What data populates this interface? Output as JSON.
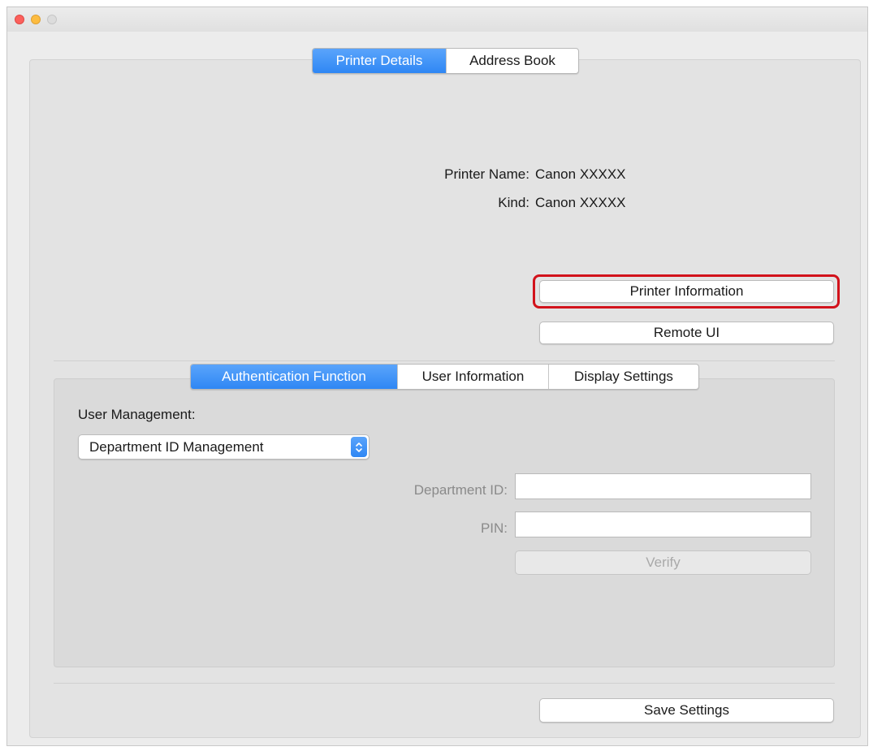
{
  "window": {
    "traffic_lights": [
      "close",
      "minimize",
      "zoom"
    ]
  },
  "top_tabs": [
    {
      "label": "Printer Details",
      "active": true
    },
    {
      "label": "Address Book",
      "active": false
    }
  ],
  "printer": {
    "name_label": "Printer Name:",
    "name_value": "Canon XXXXX",
    "kind_label": "Kind:",
    "kind_value": "Canon XXXXX"
  },
  "buttons": {
    "printer_information": "Printer Information",
    "remote_ui": "Remote UI",
    "save_settings": "Save Settings",
    "verify": "Verify"
  },
  "sub_tabs": [
    {
      "label": "Authentication Function",
      "active": true
    },
    {
      "label": "User Information",
      "active": false
    },
    {
      "label": "Display Settings",
      "active": false
    }
  ],
  "auth": {
    "user_management_label": "User Management:",
    "user_management_value": "Department ID Management",
    "department_id_label": "Department ID:",
    "department_id_value": "",
    "pin_label": "PIN:",
    "pin_value": ""
  },
  "colors": {
    "accent": "#2f87f4",
    "highlight_ring": "#d2121b",
    "close": "#fc605c",
    "minimize": "#fdbc40"
  },
  "icons": {
    "stepper": "up-down-chevron-icon"
  }
}
